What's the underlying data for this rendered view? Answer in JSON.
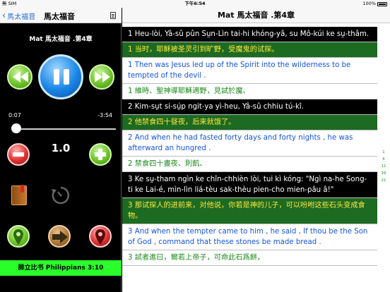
{
  "status": {
    "carrier": "無 SIM",
    "time": "下午6:54",
    "battery": "100%"
  },
  "left": {
    "back_label": "馬太福音",
    "nav_title": "馬太福音",
    "player_title": "Mat 馬太福音 .第4章",
    "time_current": "0:07",
    "time_remaining": "-3:54",
    "progress": 0.03,
    "speed": "1.0",
    "reference": "腓立比书 Philippians 3:10"
  },
  "right": {
    "title": "Mat 馬太福音 .第4章",
    "verses": [
      {
        "style": "black",
        "text": "1 Heu-lòi, Yâ-sû pûn Sṳn-Lìn tai-hi khóng-yâ, su Mô-kúi ke sṳ-thâm."
      },
      {
        "style": "green",
        "text": "1 当时，耶稣被圣灵引到旷野，受魔鬼的试探。"
      },
      {
        "style": "white-en",
        "text": "1 Then was Jesus led up of the Spirit into the wilderness to be tempted of the devil ."
      },
      {
        "style": "white-zh",
        "text": "1 維時、聖神導耶穌適野，見試於魔、"
      },
      {
        "style": "black",
        "text": "2 Kim-sṳt si-sṳ̍p ngit-ya yì-heu, Yâ-sû chhiu tú-kî."
      },
      {
        "style": "green",
        "text": "2 他禁食四十昼夜，后来就饿了。"
      },
      {
        "style": "white-en",
        "text": "2 And when he had fasted forty days and forty nights , he was afterward an hungred ."
      },
      {
        "style": "white-zh",
        "text": "2 禁食四十晝夜、則飢、"
      },
      {
        "style": "black",
        "text": "3 Ke sṳ-tham ngìn ke chîn-chhièn lòi, tui kì kóng: \"Ngì na-he Song-ti ke Lai-é, mìn-lìn liá-tèu sak-thèu pien-cho mien-pâu â!\""
      },
      {
        "style": "green",
        "text": "3 那试探人的进前来，对他说，你若是神的儿子，可以吩咐这些石头变成食物。"
      },
      {
        "style": "white-en",
        "text": "3 And when the tempter came to him , he said , If thou be the Son of God , command that these stones be made bread ."
      },
      {
        "style": "white-zh",
        "text": "3 試者進曰，爾若上帝子，可命此石爲餅，"
      }
    ],
    "index": [
      "1",
      "6",
      "11",
      "16",
      "21"
    ]
  }
}
